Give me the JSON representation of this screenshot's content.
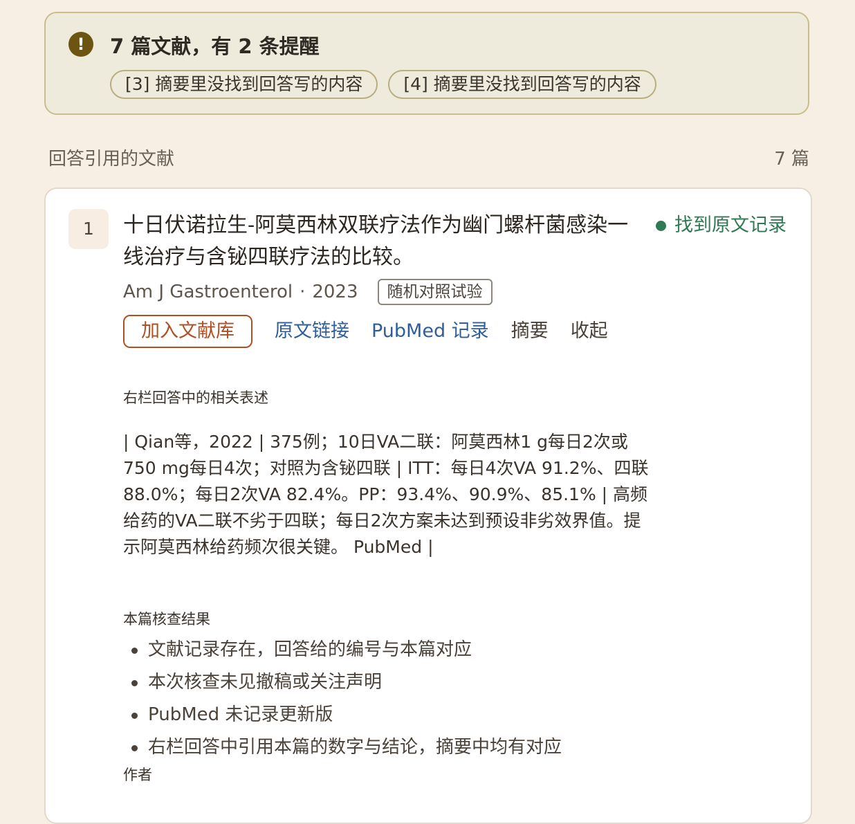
{
  "alert": {
    "icon": "exclamation-icon",
    "title": "7 篇文献，有 2 条提醒",
    "chips": [
      "[3] 摘要里没找到回答写的内容",
      "[4] 摘要里没找到回答写的内容"
    ]
  },
  "section": {
    "title": "回答引用的文献",
    "count": "7 篇"
  },
  "reference": {
    "number": "1",
    "title": "十日伏诺拉生-阿莫西林双联疗法作为幽门螺杆菌感染一线治疗与含铋四联疗法的比较。",
    "status": "找到原文记录",
    "journal": "Am J Gastroenterol",
    "separator": "·",
    "year": "2023",
    "study_type": "随机对照试验",
    "actions": {
      "add": "加入文献库",
      "full_text": "原文链接",
      "pubmed": "PubMed 记录",
      "abstract": "摘要",
      "collapse": "收起"
    },
    "statement_label": "右栏回答中的相关表述",
    "statement": "| Qian等，2022 | 375例；10日VA二联：阿莫西林1 g每日2次或750 mg每日4次；对照为含铋四联 | ITT：每日4次VA 91.2%、四联 88.0%；每日2次VA 82.4%。PP：93.4%、90.9%、85.1% | 高频给药的VA二联不劣于四联；每日2次方案未达到预设非劣效界值。提示阿莫西林给药频次很关键。 PubMed |",
    "check_label": "本篇核查结果",
    "checks": [
      "文献记录存在，回答给的编号与本篇对应",
      "本次核查未见撤稿或关注声明",
      "PubMed 未记录更新版",
      "右栏回答中引用本篇的数字与结论，摘要中均有对应"
    ],
    "authors_label": "作者"
  },
  "colors": {
    "background": "#f8efe4",
    "alert_bg": "#eeebdc",
    "status_green": "#2f7a55",
    "link_blue": "#2e5f9b",
    "add_button": "#b14f24"
  }
}
